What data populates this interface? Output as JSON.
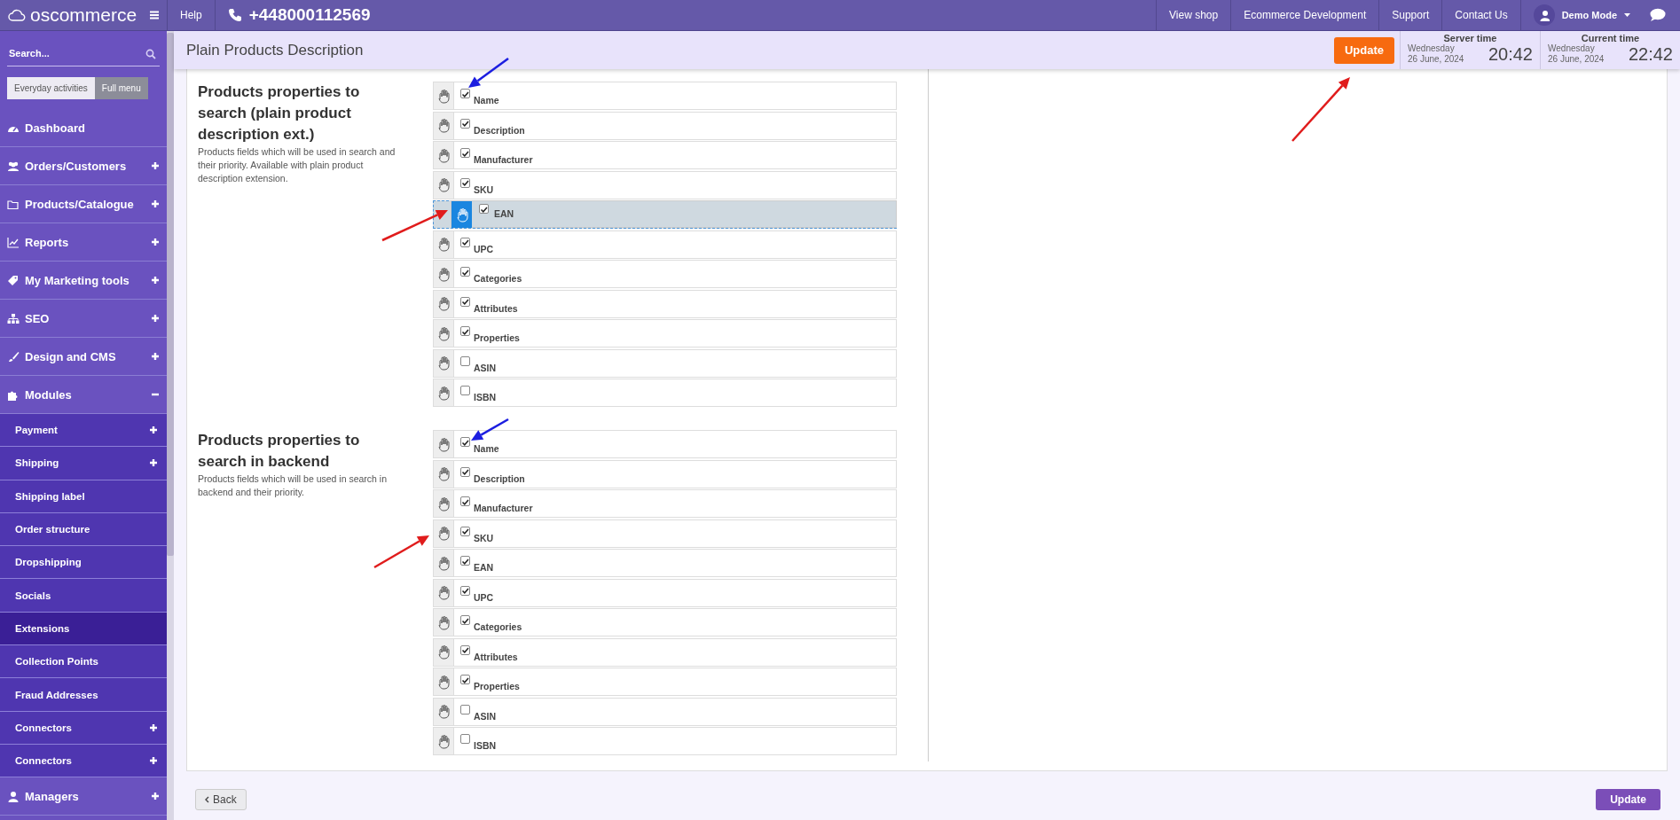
{
  "topbar": {
    "logo": "oscommerce",
    "help": "Help",
    "phone": "+448000112569",
    "links": [
      "View shop",
      "Ecommerce Development",
      "Support",
      "Contact Us"
    ],
    "user": "Demo Mode"
  },
  "sidebar": {
    "search_placeholder": "Search...",
    "modes": [
      {
        "label": "Everyday activities",
        "selected": false
      },
      {
        "label": "Full menu",
        "selected": true
      }
    ],
    "items": [
      {
        "kind": "link",
        "label": "Dashboard"
      },
      {
        "kind": "group",
        "label": "Orders/Customers",
        "expanded": false
      },
      {
        "kind": "group",
        "label": "Products/Catalogue",
        "expanded": false
      },
      {
        "kind": "group",
        "label": "Reports",
        "expanded": false
      },
      {
        "kind": "group",
        "label": "My Marketing tools",
        "expanded": false
      },
      {
        "kind": "group",
        "label": "SEO",
        "expanded": false
      },
      {
        "kind": "group",
        "label": "Design and CMS",
        "expanded": false
      },
      {
        "kind": "group",
        "label": "Modules",
        "expanded": true,
        "children": [
          {
            "kind": "group",
            "label": "Payment",
            "expanded": false,
            "selected": false
          },
          {
            "kind": "group",
            "label": "Shipping",
            "expanded": false,
            "selected": false
          },
          {
            "kind": "link",
            "label": "Shipping label",
            "selected": false
          },
          {
            "kind": "link",
            "label": "Order structure",
            "selected": false
          },
          {
            "kind": "link",
            "label": "Dropshipping",
            "selected": false
          },
          {
            "kind": "link",
            "label": "Socials",
            "selected": false
          },
          {
            "kind": "link",
            "label": "Extensions",
            "selected": true
          },
          {
            "kind": "link",
            "label": "Collection Points",
            "selected": false
          },
          {
            "kind": "link",
            "label": "Fraud Addresses",
            "selected": false
          },
          {
            "kind": "group",
            "label": "Connectors",
            "expanded": false,
            "selected": false
          },
          {
            "kind": "group",
            "label": "Connectors",
            "expanded": false,
            "selected": false
          }
        ]
      },
      {
        "kind": "group",
        "label": "Managers",
        "expanded": false
      }
    ]
  },
  "header": {
    "title": "Plain Products Description",
    "update": "Update",
    "clocks": [
      {
        "label": "Server time",
        "day": "Wednesday",
        "date": "26 June, 2024",
        "time": "20:42"
      },
      {
        "label": "Current time",
        "day": "Wednesday",
        "date": "26 June, 2024",
        "time": "22:42"
      }
    ]
  },
  "sections": [
    {
      "title": "Products properties to search (plain product description ext.)",
      "description": "Products fields which will be used in search and their priority. Available with plain product description extension.",
      "fields": [
        {
          "kind": "field",
          "label": "Name",
          "checked": true
        },
        {
          "kind": "field",
          "label": "Description",
          "checked": true
        },
        {
          "kind": "field",
          "label": "Manufacturer",
          "checked": true
        },
        {
          "kind": "field",
          "label": "SKU",
          "checked": true
        },
        {
          "kind": "placeholder"
        },
        {
          "kind": "field",
          "label": "UPC",
          "checked": true
        },
        {
          "kind": "field",
          "label": "Categories",
          "checked": true
        },
        {
          "kind": "field",
          "label": "Attributes",
          "checked": true
        },
        {
          "kind": "field",
          "label": "Properties",
          "checked": true
        },
        {
          "kind": "field",
          "label": "ASIN",
          "checked": false
        },
        {
          "kind": "field",
          "label": "ISBN",
          "checked": false
        }
      ],
      "dragging": {
        "label": "EAN",
        "checked": true
      }
    },
    {
      "title": "Products properties to search in backend",
      "description": "Products fields which will be used in search in backend and their priority.",
      "fields": [
        {
          "kind": "field",
          "label": "Name",
          "checked": true
        },
        {
          "kind": "field",
          "label": "Description",
          "checked": true
        },
        {
          "kind": "field",
          "label": "Manufacturer",
          "checked": true
        },
        {
          "kind": "field",
          "label": "SKU",
          "checked": true
        },
        {
          "kind": "field",
          "label": "EAN",
          "checked": true
        },
        {
          "kind": "field",
          "label": "UPC",
          "checked": true
        },
        {
          "kind": "field",
          "label": "Categories",
          "checked": true
        },
        {
          "kind": "field",
          "label": "Attributes",
          "checked": true
        },
        {
          "kind": "field",
          "label": "Properties",
          "checked": true
        },
        {
          "kind": "field",
          "label": "ASIN",
          "checked": false
        },
        {
          "kind": "field",
          "label": "ISBN",
          "checked": false
        }
      ]
    }
  ],
  "footer": {
    "back": "Back",
    "update": "Update"
  },
  "annotations": [
    {
      "color": "#1c1ee0"
    },
    {
      "color": "#e01c1c"
    },
    {
      "color": "#e01c1c"
    },
    {
      "color": "#1c1ee0"
    },
    {
      "color": "#e01c1c"
    }
  ]
}
